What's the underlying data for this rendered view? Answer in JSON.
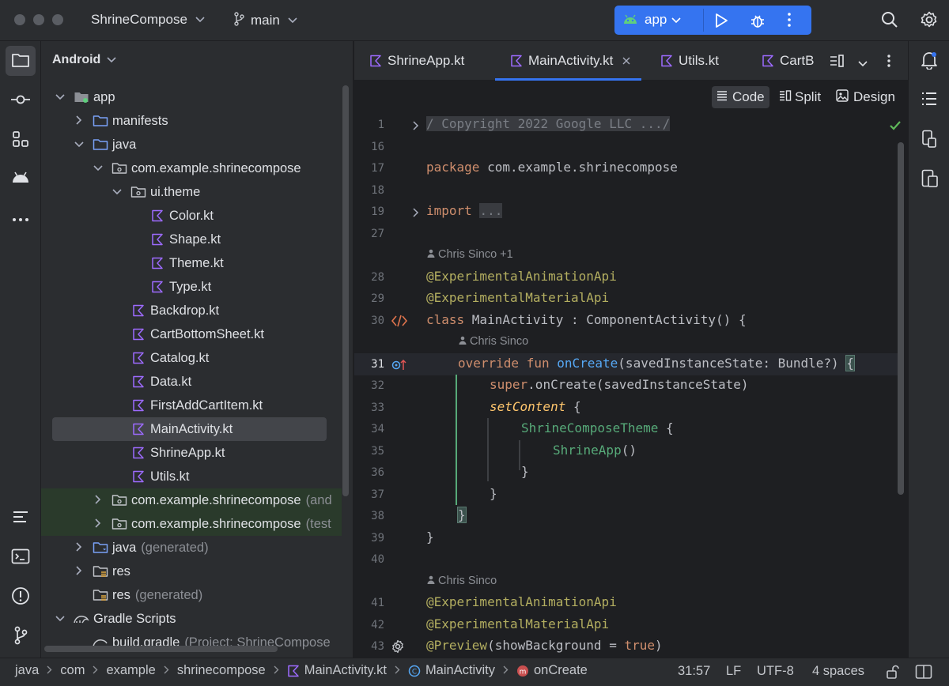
{
  "titlebar": {
    "project_name": "ShrineCompose",
    "branch": "main",
    "run_config": "app"
  },
  "project_panel": {
    "header": "Android",
    "items": [
      {
        "label": "app",
        "suffix": "",
        "level": 0,
        "arrow": "down",
        "icon": "module-icon"
      },
      {
        "label": "manifests",
        "suffix": "",
        "level": 1,
        "arrow": "right",
        "icon": "folder-icon"
      },
      {
        "label": "java",
        "suffix": "",
        "level": 1,
        "arrow": "down",
        "icon": "folder-icon"
      },
      {
        "label": "com.example.shrinecompose",
        "suffix": "",
        "level": 2,
        "arrow": "down",
        "icon": "package-icon"
      },
      {
        "label": "ui.theme",
        "suffix": "",
        "level": 3,
        "arrow": "down",
        "icon": "package-icon"
      },
      {
        "label": "Color.kt",
        "suffix": "",
        "level": 4,
        "arrow": "",
        "icon": "kotlin-file-icon"
      },
      {
        "label": "Shape.kt",
        "suffix": "",
        "level": 4,
        "arrow": "",
        "icon": "kotlin-file-icon"
      },
      {
        "label": "Theme.kt",
        "suffix": "",
        "level": 4,
        "arrow": "",
        "icon": "kotlin-file-icon"
      },
      {
        "label": "Type.kt",
        "suffix": "",
        "level": 4,
        "arrow": "",
        "icon": "kotlin-file-icon"
      },
      {
        "label": "Backdrop.kt",
        "suffix": "",
        "level": 3,
        "arrow": "",
        "icon": "kotlin-file-icon"
      },
      {
        "label": "CartBottomSheet.kt",
        "suffix": "",
        "level": 3,
        "arrow": "",
        "icon": "kotlin-file-icon"
      },
      {
        "label": "Catalog.kt",
        "suffix": "",
        "level": 3,
        "arrow": "",
        "icon": "kotlin-file-icon"
      },
      {
        "label": "Data.kt",
        "suffix": "",
        "level": 3,
        "arrow": "",
        "icon": "kotlin-file-icon"
      },
      {
        "label": "FirstAddCartItem.kt",
        "suffix": "",
        "level": 3,
        "arrow": "",
        "icon": "kotlin-file-icon"
      },
      {
        "label": "MainActivity.kt",
        "suffix": "",
        "level": 3,
        "arrow": "",
        "icon": "kotlin-file-icon",
        "selected": true
      },
      {
        "label": "ShrineApp.kt",
        "suffix": "",
        "level": 3,
        "arrow": "",
        "icon": "kotlin-file-icon"
      },
      {
        "label": "Utils.kt",
        "suffix": "",
        "level": 3,
        "arrow": "",
        "icon": "kotlin-file-icon"
      },
      {
        "label": "com.example.shrinecompose",
        "suffix": "(and",
        "level": 2,
        "arrow": "right",
        "icon": "package-icon",
        "tinted": true
      },
      {
        "label": "com.example.shrinecompose",
        "suffix": "(test",
        "level": 2,
        "arrow": "right",
        "icon": "package-icon",
        "tinted": true
      },
      {
        "label": "java",
        "suffix": "(generated)",
        "level": 1,
        "arrow": "right",
        "icon": "generated-folder-icon"
      },
      {
        "label": "res",
        "suffix": "",
        "level": 1,
        "arrow": "right",
        "icon": "resource-folder-icon"
      },
      {
        "label": "res",
        "suffix": "(generated)",
        "level": 1,
        "arrow": "",
        "icon": "resource-folder-icon"
      },
      {
        "label": "Gradle Scripts",
        "suffix": "",
        "level": 0,
        "arrow": "down",
        "icon": "gradle-icon"
      },
      {
        "label": "build.gradle",
        "suffix": "(Project: ShrineCompose",
        "level": 1,
        "arrow": "",
        "icon": "gradle-file-icon"
      }
    ]
  },
  "editor_tabs": [
    {
      "label": "ShrineApp.kt",
      "active": false,
      "closable": false
    },
    {
      "label": "MainActivity.kt",
      "active": true,
      "closable": true
    },
    {
      "label": "Utils.kt",
      "active": false,
      "closable": false
    },
    {
      "label": "CartB",
      "active": false,
      "closable": false
    }
  ],
  "view_modes": {
    "code": "Code",
    "split": "Split",
    "design": "Design"
  },
  "code_lines": [
    {
      "num": "1",
      "fold": true,
      "gutter": "",
      "tokens": [
        [
          "/ Copyright 2022 Google LLC .../",
          "fold"
        ]
      ]
    },
    {
      "num": "16",
      "tokens": []
    },
    {
      "num": "17",
      "tokens": [
        [
          "package ",
          "kw"
        ],
        [
          "com.example.shrinecompose",
          "plain"
        ]
      ]
    },
    {
      "num": "18",
      "tokens": []
    },
    {
      "num": "19",
      "fold": true,
      "tokens": [
        [
          "import ",
          "kw"
        ],
        [
          "...",
          "fold"
        ]
      ]
    },
    {
      "num": "27",
      "tokens": []
    },
    {
      "author": "Chris Sinco +1",
      "indent": 0
    },
    {
      "num": "28",
      "tokens": [
        [
          "@ExperimentalAnimationApi",
          "anno"
        ]
      ]
    },
    {
      "num": "29",
      "tokens": [
        [
          "@ExperimentalMaterialApi",
          "anno"
        ]
      ]
    },
    {
      "num": "30",
      "gutter": "code-icon",
      "tokens": [
        [
          "class ",
          "kw"
        ],
        [
          "MainActivity : ComponentActivity() {",
          "plain"
        ]
      ]
    },
    {
      "author": "Chris Sinco",
      "indent": 1
    },
    {
      "num": "31",
      "gutter": "override-icon",
      "current": true,
      "tokens": [
        [
          "override fun ",
          "kw",
          1
        ],
        [
          "onCreate",
          "fn"
        ],
        [
          "(savedInstanceState: Bundle?) ",
          "plain"
        ],
        [
          "{",
          "brace"
        ]
      ]
    },
    {
      "num": "32",
      "tokens": [
        [
          "super",
          "kw",
          2
        ],
        [
          ".onCreate(savedInstanceState)",
          "plain"
        ]
      ]
    },
    {
      "num": "33",
      "tokens": [
        [
          "setContent",
          "fnit",
          2
        ],
        [
          " {",
          "plain"
        ]
      ]
    },
    {
      "num": "34",
      "tokens": [
        [
          "ShrineComposeTheme",
          "comp",
          3
        ],
        [
          " {",
          "plain"
        ]
      ]
    },
    {
      "num": "35",
      "tokens": [
        [
          "ShrineApp",
          "comp",
          4
        ],
        [
          "()",
          "plain"
        ]
      ]
    },
    {
      "num": "36",
      "tokens": [
        [
          "}",
          "plain",
          3
        ]
      ]
    },
    {
      "num": "37",
      "tokens": [
        [
          "}",
          "plain",
          2
        ]
      ]
    },
    {
      "num": "38",
      "tokens": [
        [
          "}",
          "brace",
          1
        ]
      ]
    },
    {
      "num": "39",
      "tokens": [
        [
          "}",
          "plain"
        ]
      ]
    },
    {
      "num": "40",
      "tokens": []
    },
    {
      "author": "Chris Sinco",
      "indent": 0
    },
    {
      "num": "41",
      "tokens": [
        [
          "@ExperimentalAnimationApi",
          "anno"
        ]
      ]
    },
    {
      "num": "42",
      "tokens": [
        [
          "@ExperimentalMaterialApi",
          "anno"
        ]
      ]
    },
    {
      "num": "43",
      "gutter": "gear-icon",
      "tokens": [
        [
          "@Preview",
          "anno"
        ],
        [
          "(showBackground = ",
          "plain"
        ],
        [
          "true",
          "kw"
        ],
        [
          ")",
          "plain"
        ]
      ]
    }
  ],
  "status": {
    "crumbs": [
      "java",
      "com",
      "example",
      "shrinecompose",
      "MainActivity.kt",
      "MainActivity",
      "onCreate"
    ],
    "position": "31:57",
    "line_sep": "LF",
    "encoding": "UTF-8",
    "indent": "4 spaces"
  },
  "colors": {
    "keyword": "#cf8e6d",
    "annotation": "#b3ae60",
    "function": "#56a8f5",
    "composable": "#57aa79",
    "fn_italic": "#ffc66d",
    "accent": "#3574f0",
    "kotlin": "#9d6bff"
  }
}
